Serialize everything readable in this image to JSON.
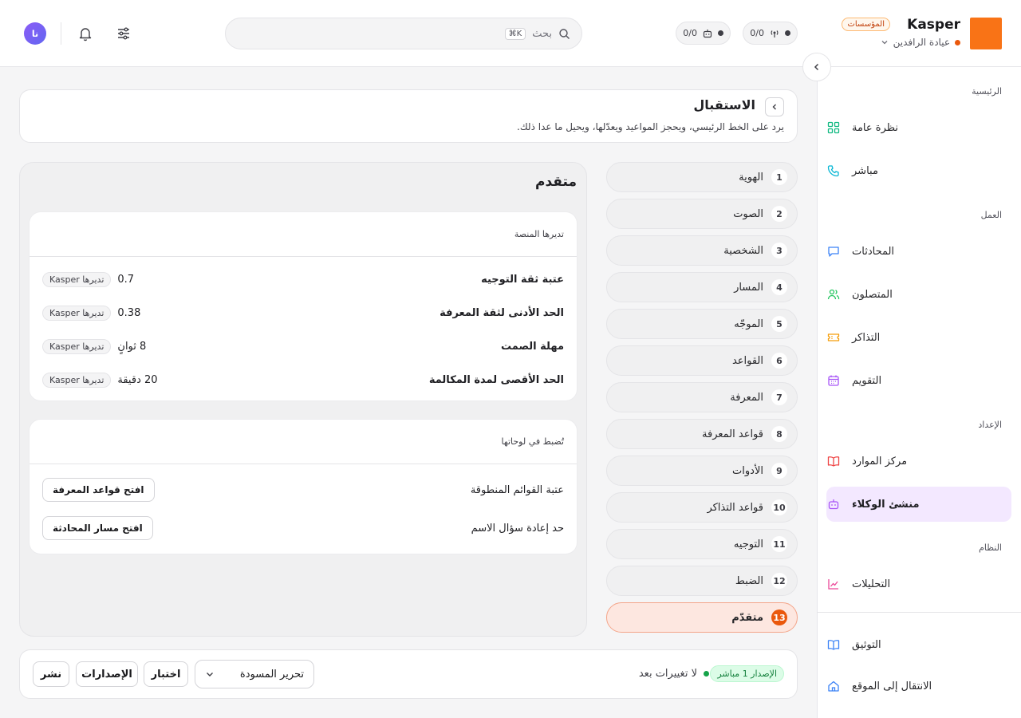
{
  "brand": {
    "name": "Kasper",
    "badge": "المؤسسات",
    "org": "عيادة الرافدين"
  },
  "topbar": {
    "stats": [
      {
        "value": "0/0",
        "icon": "broadcast-icon"
      },
      {
        "value": "0/0",
        "icon": "robot-icon"
      }
    ],
    "search": {
      "placeholder": "بحث",
      "shortcut": "⌘K"
    },
    "avatar_initials": "نا"
  },
  "sidebar": {
    "sections": [
      {
        "title": "الرئيسية",
        "items": [
          {
            "label": "نظرة عامة",
            "icon": "grid-icon",
            "color": "#10b981"
          },
          {
            "label": "مباشر",
            "icon": "phone-icon",
            "color": "#06b6d4"
          }
        ]
      },
      {
        "title": "العمل",
        "items": [
          {
            "label": "المحادثات",
            "icon": "chat-icon",
            "color": "#3b82f6"
          },
          {
            "label": "المتصلون",
            "icon": "users-icon",
            "color": "#22c55e"
          },
          {
            "label": "التذاكر",
            "icon": "ticket-icon",
            "color": "#f59e0b"
          },
          {
            "label": "التقويم",
            "icon": "calendar-icon",
            "color": "#a855f7"
          }
        ]
      },
      {
        "title": "الإعداد",
        "items": [
          {
            "label": "مركز الموارد",
            "icon": "book-icon",
            "color": "#ef4444"
          },
          {
            "label": "منشئ الوكلاء",
            "icon": "robot-icon",
            "color": "#a855f7"
          }
        ]
      },
      {
        "title": "النظام",
        "items": [
          {
            "label": "التحليلات",
            "icon": "chart-icon",
            "color": "#ec4899"
          }
        ]
      }
    ],
    "footer": [
      {
        "label": "التوثيق",
        "icon": "docs-icon",
        "color": "#3b82f6"
      },
      {
        "label": "الانتقال إلى الموقع",
        "icon": "home-icon",
        "color": "#3b82f6"
      }
    ]
  },
  "header": {
    "title": "الاستقبال",
    "subtitle": "يرد على الخط الرئيسي، ويحجز المواعيد ويعدّلها، ويحيل ما عدا ذلك."
  },
  "steps": [
    {
      "num": "1",
      "label": "الهوية"
    },
    {
      "num": "2",
      "label": "الصوت"
    },
    {
      "num": "3",
      "label": "الشخصية"
    },
    {
      "num": "4",
      "label": "المسار"
    },
    {
      "num": "5",
      "label": "الموجّه"
    },
    {
      "num": "6",
      "label": "القواعد"
    },
    {
      "num": "7",
      "label": "المعرفة"
    },
    {
      "num": "8",
      "label": "قواعد المعرفة"
    },
    {
      "num": "9",
      "label": "الأدوات"
    },
    {
      "num": "10",
      "label": "قواعد التذاكر"
    },
    {
      "num": "11",
      "label": "التوجيه"
    },
    {
      "num": "12",
      "label": "الضبط"
    },
    {
      "num": "13",
      "label": "متقدّم"
    }
  ],
  "advanced": {
    "title": "متقدم",
    "platform_card": {
      "heading": "تديرها المنصة",
      "rows": [
        {
          "label": "عتبة ثقة التوجيه",
          "value": "0.7",
          "badge": "تديرها Kasper"
        },
        {
          "label": "الحد الأدنى لثقة المعرفة",
          "value": "0.38",
          "badge": "تديرها Kasper"
        },
        {
          "label": "مهلة الصمت",
          "value": "8 ثوانٍ",
          "badge": "تديرها Kasper"
        },
        {
          "label": "الحد الأقصى لمدة المكالمة",
          "value": "20 دقيقة",
          "badge": "تديرها Kasper"
        }
      ]
    },
    "panels_card": {
      "heading": "تُضبط في لوحاتها",
      "rows": [
        {
          "label": "عتبة القوائم المنطوقة",
          "button": "افتح قواعد المعرفة"
        },
        {
          "label": "حد إعادة سؤال الاسم",
          "button": "افتح مسار المحادثة"
        }
      ]
    }
  },
  "bottombar": {
    "version_badge": "الإصدار 1 مباشر",
    "status": "لا تغييرات بعد",
    "draft_select": "تحرير المسودة",
    "test": "اختبار",
    "versions": "الإصدارات",
    "publish": "نشر"
  },
  "colors": {
    "accent": "#ea580c",
    "brand": "#f97316",
    "active_nav": "#f3e8ff"
  }
}
